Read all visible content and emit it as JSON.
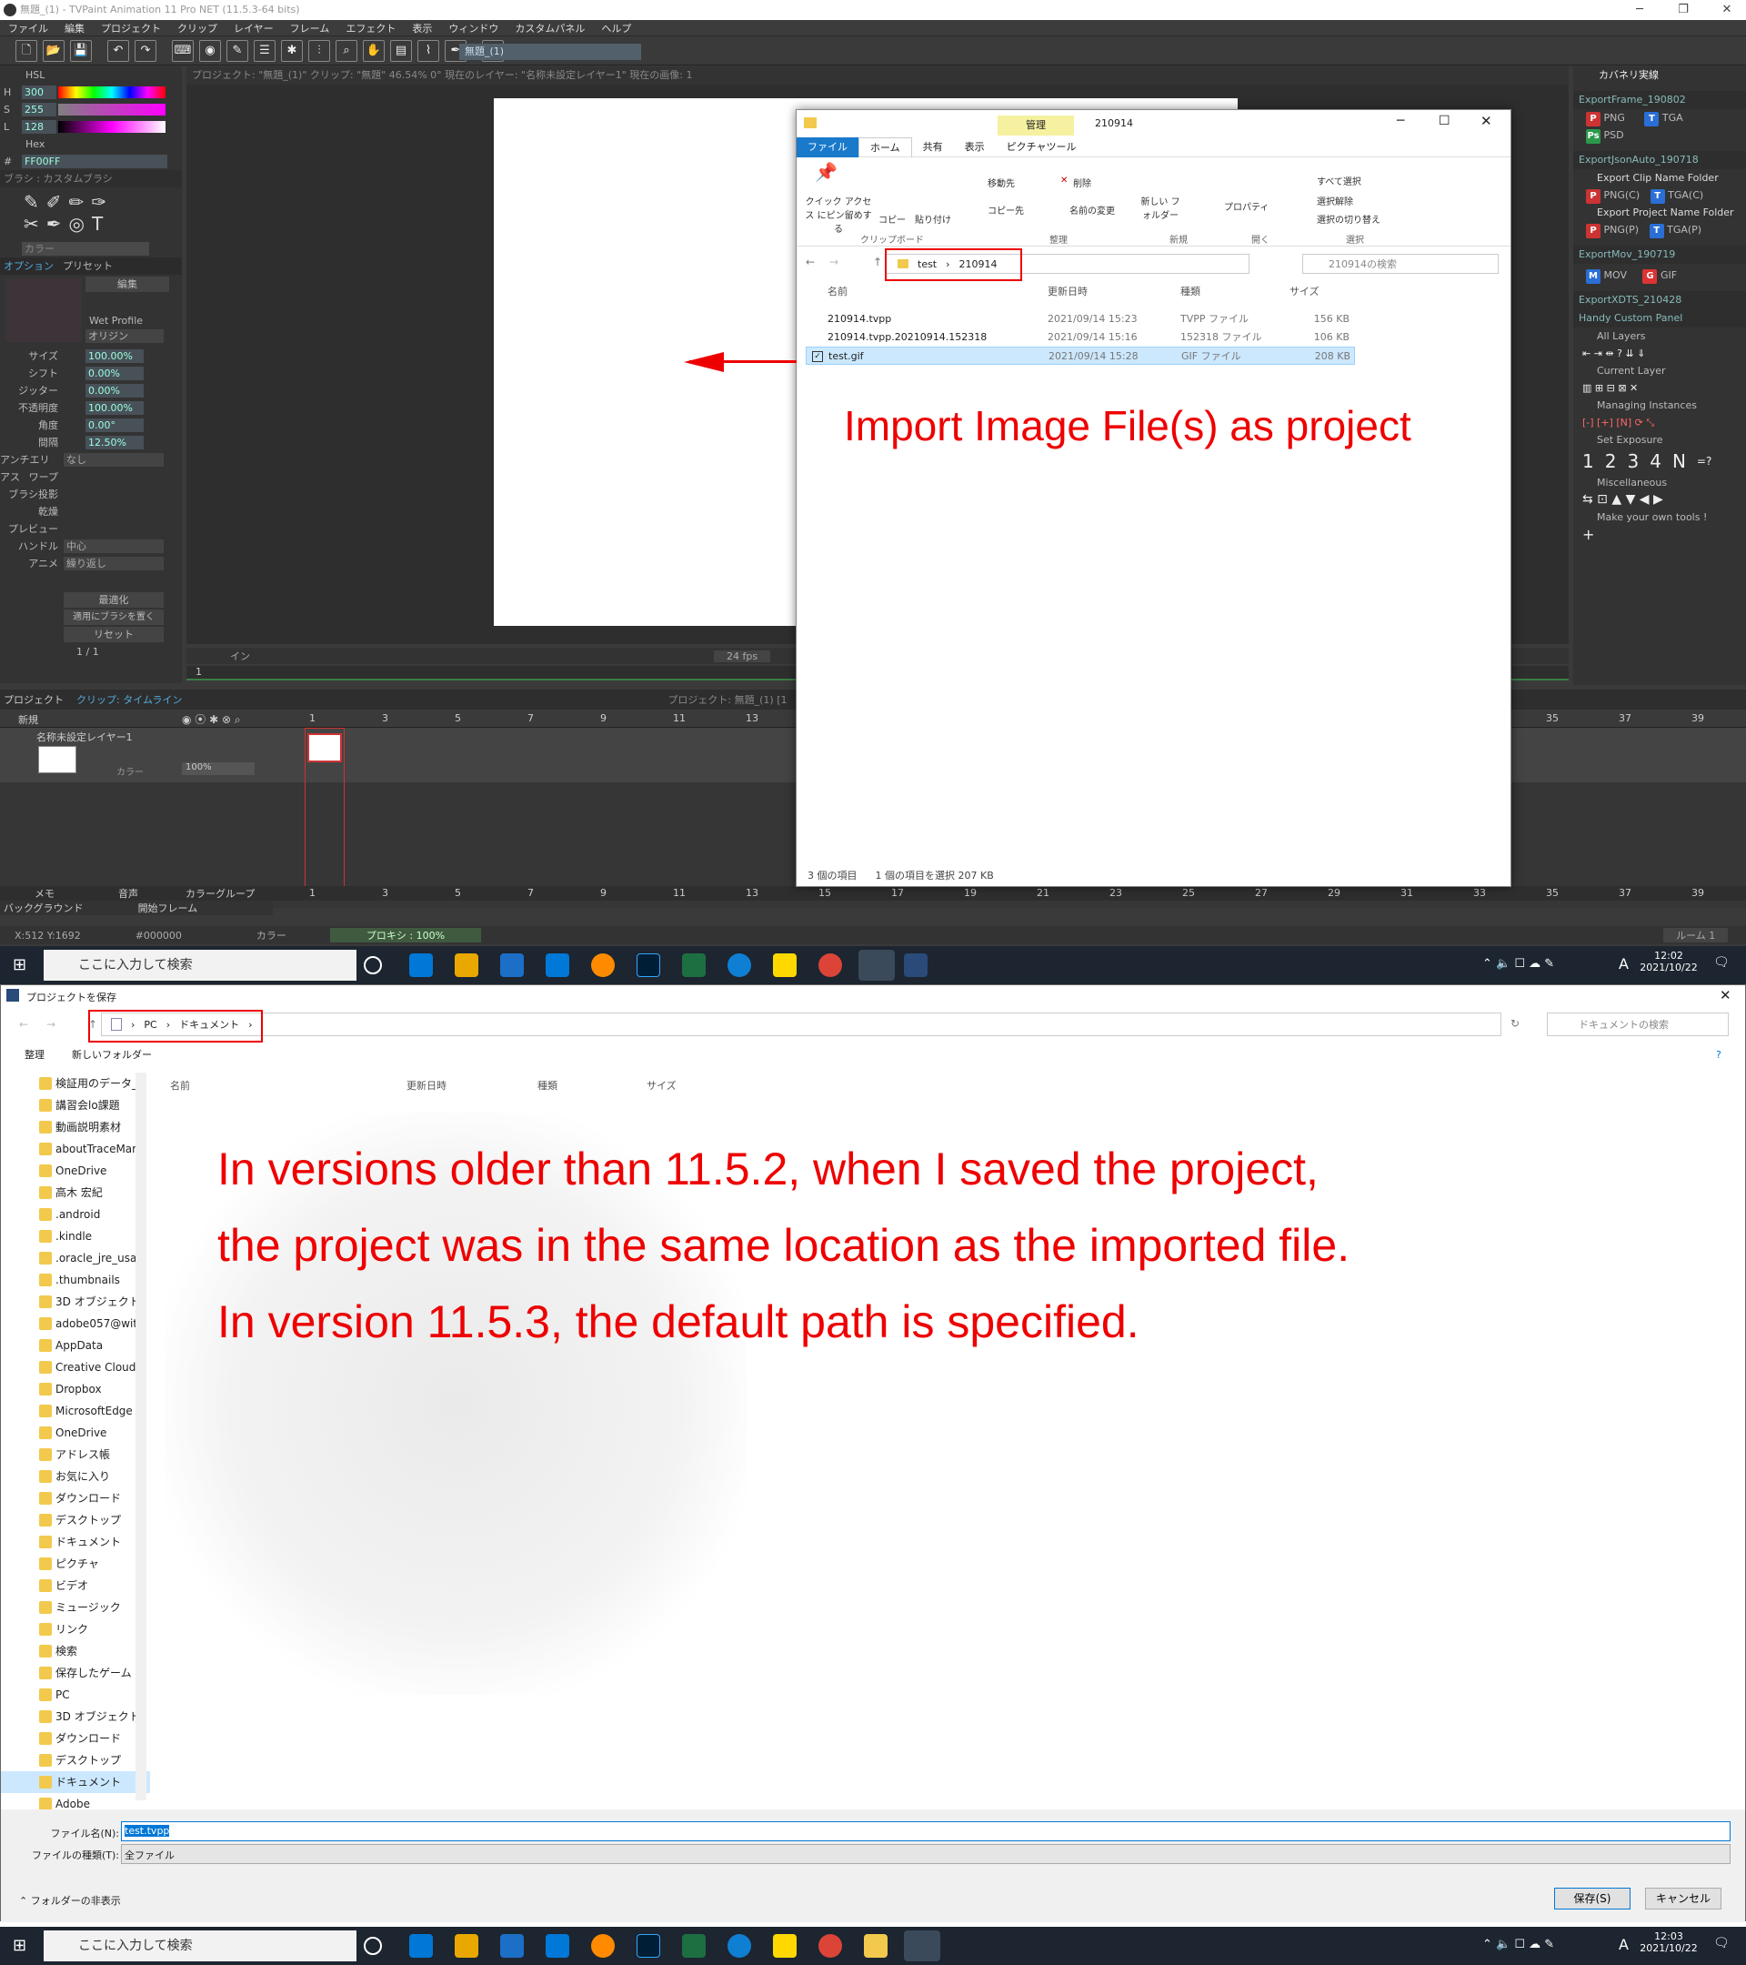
{
  "app": {
    "title": "無題_(1) - TVPaint Animation 11 Pro NET (11.5.3-64 bits)",
    "menu": [
      "ファイル",
      "編集",
      "プロジェクト",
      "クリップ",
      "レイヤー",
      "フレーム",
      "エフェクト",
      "表示",
      "ウィンドウ",
      "カスタムパネル",
      "ヘルプ"
    ],
    "doc_tab": "無題_(1)",
    "info_bar": "プロジェクト: \"無題_(1)\" クリップ: \"無題\" 46.54% 0° 現在のレイヤー: \"名称未設定レイヤー1\" 現在の画像: 1",
    "color": {
      "mode": "HSL",
      "h_label": "H",
      "h": "300",
      "s_label": "S",
      "s": "255",
      "l_label": "L",
      "l": "128",
      "hex_label": "Hex",
      "hash": "#",
      "hex": "FF00FF"
    },
    "brush": {
      "title": "ブラシ : カスタムブラシ",
      "color_label": "カラー",
      "tab_option": "オプション",
      "tab_preset": "プリセット",
      "edit": "編集",
      "wet_profile": "Wet Profile",
      "origin": "オリジン",
      "params": [
        {
          "label": "サイズ",
          "value": "100.00%"
        },
        {
          "label": "シフト",
          "value": "0.00%"
        },
        {
          "label": "ジッター",
          "value": "0.00%"
        },
        {
          "label": "不透明度",
          "value": "100.00%"
        },
        {
          "label": "角度",
          "value": "0.00°"
        },
        {
          "label": "間隔",
          "value": "12.50%"
        }
      ],
      "antialias_label": "アンチエリアス",
      "antialias": "なし",
      "warp": "ワープ",
      "brush_proj": "ブラシ投影",
      "dry": "乾燥",
      "preview": "プレビュー",
      "handle_label": "ハンドル",
      "handle": "中心",
      "anime_label": "アニメ",
      "anime": "繰り返し",
      "btn_optimize": "最適化",
      "btn_adapt": "適用にブラシを置く",
      "btn_reset": "リセット",
      "page": "1 / 1"
    },
    "canvas_bottom": {
      "in_label": "イン",
      "fps": "24 fps",
      "frame": "1"
    },
    "right_panel": {
      "header": "カバネリ実線",
      "sections": [
        {
          "title": "ExportFrame_190802",
          "items": [
            "PNG",
            "TGA",
            "PSD"
          ]
        },
        {
          "title": "ExportJsonAuto_190718",
          "sub1": "Export Clip Name Folder",
          "items1": [
            "PNG(C)",
            "TGA(C)"
          ],
          "sub2": "Export Project Name Folder",
          "items2": [
            "PNG(P)",
            "TGA(P)"
          ]
        },
        {
          "title": "ExportMov_190719",
          "items": [
            "MOV",
            "GIF"
          ]
        },
        {
          "title": "ExportXDTS_210428"
        },
        {
          "title": "Handy Custom Panel",
          "groups": [
            "All Layers",
            "Current Layer",
            "Managing Instances",
            "Set Exposure",
            "Miscellaneous",
            "Make your own tools !"
          ],
          "exposure": [
            "1",
            "2",
            "3",
            "4",
            "N",
            "=?"
          ]
        }
      ]
    },
    "timeline": {
      "tab_project": "プロジェクト",
      "tab_clip": "クリップ: タイムライン",
      "title": "プロジェクト: 無題_(1) [1",
      "new": "新規",
      "layer_name": "名称未設定レイヤー1",
      "color_label": "カラー",
      "opacity": "100%",
      "numbers": [
        "1",
        "3",
        "5",
        "7",
        "9",
        "11",
        "13",
        "15",
        "17",
        "19",
        "21",
        "23",
        "25",
        "27",
        "29",
        "31",
        "33",
        "35",
        "37",
        "39"
      ],
      "bottom_tabs": [
        "メモ",
        "音声",
        "カラーグループ"
      ],
      "background": "バックグラウンド",
      "start_frame": "開始フレーム"
    },
    "status": {
      "coords": "X:512 Y:1692",
      "color": "#000000",
      "color_label": "カラー",
      "proxy": "プロキシ : 100%",
      "room": "ルーム 1"
    }
  },
  "explorer": {
    "title": "210914",
    "manage": "管理",
    "tabs": [
      "ファイル",
      "ホーム",
      "共有",
      "表示",
      "ピクチャツール"
    ],
    "ribbon": {
      "quick": "クイック アクセス にピン留めする",
      "copy": "コピー",
      "paste": "貼り付け",
      "clipboard": "クリップボード",
      "move": "移動先",
      "delete": "削除",
      "copy_to": "コピー先",
      "rename": "名前の変更",
      "organize": "整理",
      "new_folder": "新しい フォルダー",
      "new": "新規",
      "props": "プロパティ",
      "open": "開く",
      "select_all": "すべて選択",
      "select_none": "選択解除",
      "invert": "選択の切り替え",
      "select": "選択"
    },
    "breadcrumb": [
      "test",
      "210914"
    ],
    "search_placeholder": "210914の検索",
    "columns": [
      "名前",
      "更新日時",
      "種類",
      "サイズ"
    ],
    "files": [
      {
        "name": "210914.tvpp",
        "date": "2021/09/14 15:23",
        "type": "TVPP ファイル",
        "size": "156 KB"
      },
      {
        "name": "210914.tvpp.20210914.152318",
        "date": "2021/09/14 15:16",
        "type": "152318 ファイル",
        "size": "106 KB"
      },
      {
        "name": "test.gif",
        "date": "2021/09/14 15:28",
        "type": "GIF ファイル",
        "size": "208 KB"
      }
    ],
    "status_items": "3 個の項目",
    "status_selected": "1 個の項目を選択  207 KB"
  },
  "annotation_top": "Import Image File(s) as project",
  "annotation_bottom": [
    "In versions older than 11.5.2, when I saved the project,",
    "the project was in the same location as the imported file.",
    "In version 11.5.3, the default path is specified."
  ],
  "taskbar": {
    "search": "ここに入力して検索",
    "time1": "12:02",
    "date1": "2021/10/22",
    "time2": "12:03",
    "date2": "2021/10/22",
    "ime": "A"
  },
  "save_dialog": {
    "title": "プロジェクトを保存",
    "breadcrumb": [
      "PC",
      "ドキュメント"
    ],
    "search_placeholder": "ドキュメントの検索",
    "organize": "整理",
    "new_folder": "新しいフォルダー",
    "columns": [
      "名前",
      "更新日時",
      "種類",
      "サイズ"
    ],
    "tree": [
      "検証用のデータ_",
      "講習会lo課題",
      "動画説明素材",
      "aboutTraceMar",
      "OneDrive",
      "高木 宏紀",
      ".android",
      ".kindle",
      ".oracle_jre_usa",
      ".thumbnails",
      "3D オブジェクト",
      "adobe057@wit",
      "AppData",
      "Creative Cloud",
      "Dropbox",
      "MicrosoftEdge",
      "OneDrive",
      "アドレス帳",
      "お気に入り",
      "ダウンロード",
      "デスクトップ",
      "ドキュメント",
      "ピクチャ",
      "ビデオ",
      "ミュージック",
      "リンク",
      "検索",
      "保存したゲーム",
      "PC",
      "3D オブジェクト",
      "ダウンロード",
      "デスクトップ",
      "ドキュメント",
      "Adobe"
    ],
    "filename_label": "ファイル名(N):",
    "filename": "test.tvpp",
    "filetype_label": "ファイルの種類(T):",
    "filetype": "全ファイル",
    "hide_folders": "フォルダーの非表示",
    "save_btn": "保存(S)",
    "cancel_btn": "キャンセル"
  },
  "colors": {
    "accent": "#0078d7",
    "annotation": "#e00000",
    "tvp_bg": "#3a3a3a",
    "selection": "#cce8ff"
  }
}
